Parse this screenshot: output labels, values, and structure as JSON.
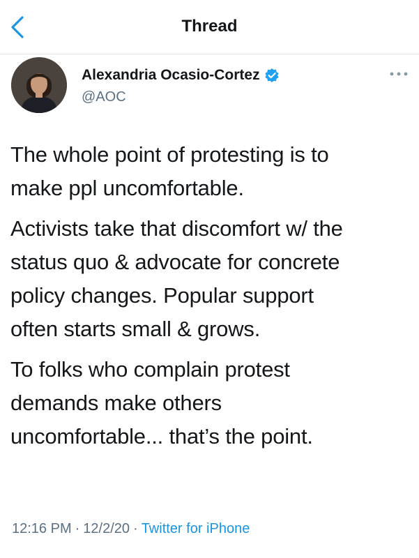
{
  "header": {
    "title": "Thread",
    "back_icon": "chevron-left-icon",
    "accent_color": "#1b95e0"
  },
  "author": {
    "display_name": "Alexandria Ocasio-Cortez",
    "handle": "@AOC",
    "verified": true,
    "verified_icon": "verified-badge-icon",
    "verified_color": "#1da1f2",
    "more_icon": "more-dots-icon"
  },
  "tweet": {
    "paragraphs": [
      "The whole point of protesting is to\nmake ppl uncomfortable.",
      "Activists take that discomfort w/ the\nstatus quo & advocate for concrete\npolicy changes. Popular support\noften starts small & grows.",
      "To folks who complain protest\ndemands make others\nuncomfortable... that’s the point."
    ]
  },
  "meta": {
    "time": "12:16 PM",
    "date": "12/2/20",
    "separator": "·",
    "source": "Twitter for iPhone",
    "source_color": "#1b95e0"
  }
}
